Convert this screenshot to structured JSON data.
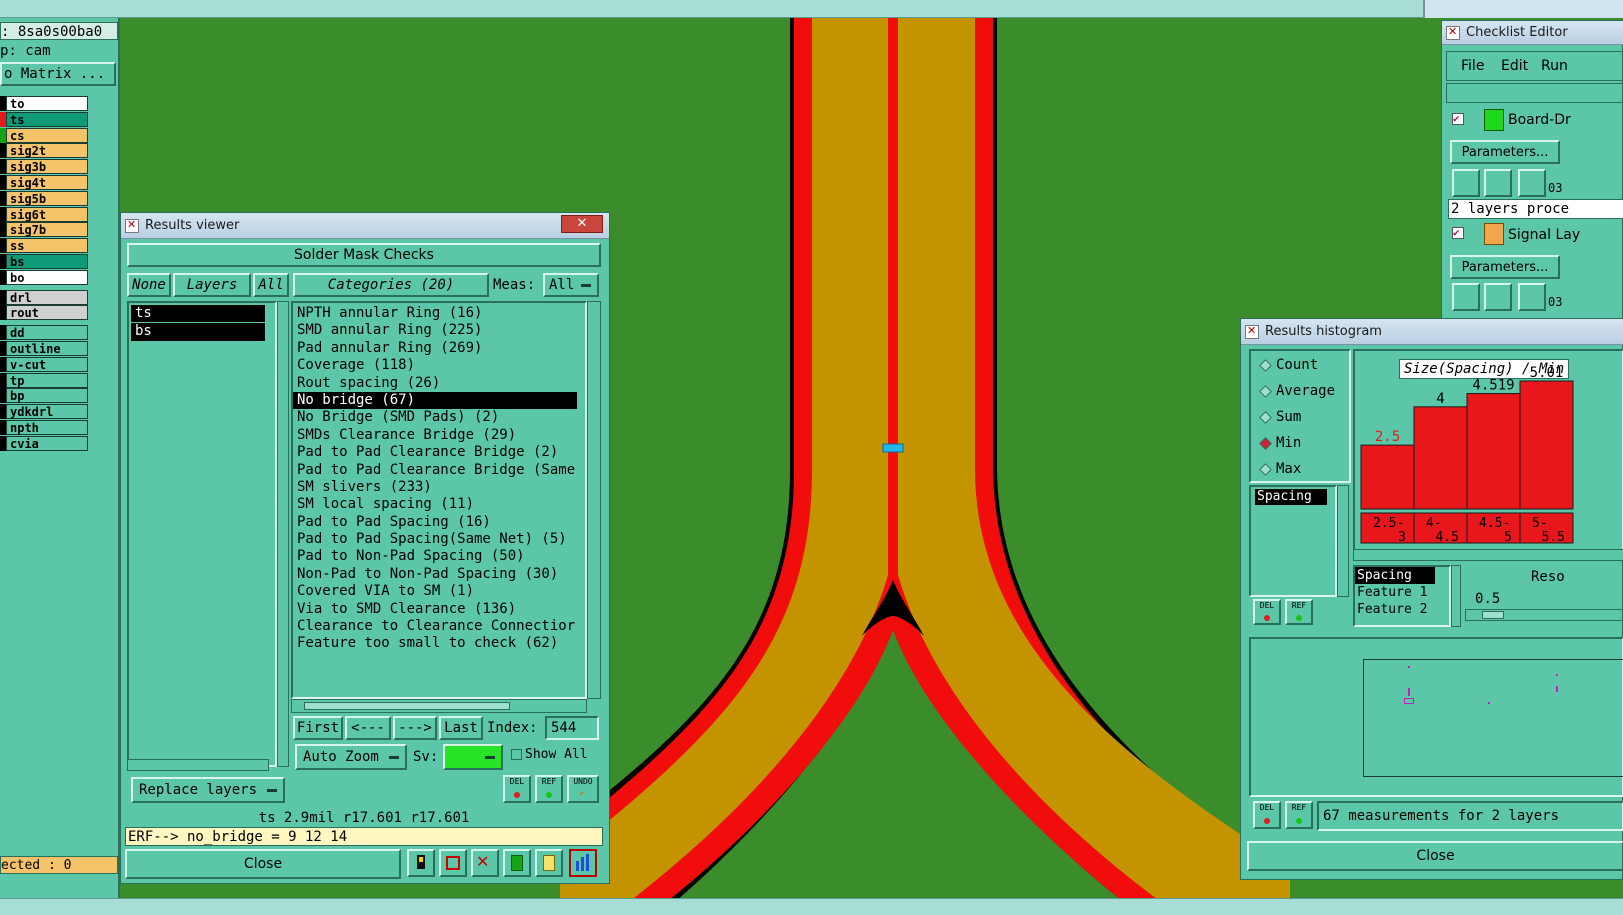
{
  "job_info": {
    "job_line": ": 8sa0s00ba0",
    "step_line": "p: cam",
    "matrix_button": "o Matrix ..."
  },
  "layers": [
    {
      "name": "to",
      "color": "#ffffff"
    },
    {
      "name": "ts",
      "color": "#0f9a78",
      "selected": true
    },
    {
      "name": "cs",
      "color": "#f5c46a"
    },
    {
      "name": "sig2t",
      "color": "#f5c46a"
    },
    {
      "name": "sig3b",
      "color": "#f5c46a"
    },
    {
      "name": "sig4t",
      "color": "#f5c46a"
    },
    {
      "name": "sig5b",
      "color": "#f5c46a"
    },
    {
      "name": "sig6t",
      "color": "#f5c46a"
    },
    {
      "name": "sig7b",
      "color": "#f5c46a"
    },
    {
      "name": "ss",
      "color": "#f5c46a"
    },
    {
      "name": "bs",
      "color": "#0f9a78"
    },
    {
      "name": "bo",
      "color": "#ffffff"
    },
    {
      "name": "drl",
      "color": "#d0d0d0"
    },
    {
      "name": "rout",
      "color": "#d0d0d0"
    },
    {
      "name": "dd",
      "color": "#5cc7a8"
    },
    {
      "name": "outline",
      "color": "#5cc7a8"
    },
    {
      "name": "v-cut",
      "color": "#5cc7a8"
    },
    {
      "name": "tp",
      "color": "#5cc7a8"
    },
    {
      "name": "bp",
      "color": "#5cc7a8"
    },
    {
      "name": "ydkdrl",
      "color": "#5cc7a8"
    },
    {
      "name": "npth",
      "color": "#5cc7a8"
    },
    {
      "name": "cvia",
      "color": "#5cc7a8"
    }
  ],
  "selected_count": "ected : 0",
  "results_viewer": {
    "title": "Results viewer",
    "header": "Solder Mask Checks",
    "none_btn": "None",
    "layers_btn": "Layers",
    "all_btn": "All",
    "categories_btn": "Categories (20)",
    "meas_label": "Meas:",
    "meas_value": "All",
    "layer_list": [
      "ts",
      "bs"
    ],
    "categories": [
      "NPTH annular Ring (16)",
      "SMD annular Ring (225)",
      "Pad annular Ring (269)",
      "Coverage (118)",
      "Rout spacing (26)",
      "No bridge (67)",
      "No Bridge (SMD Pads) (2)",
      "SMDs Clearance Bridge (29)",
      "Pad to Pad Clearance Bridge (2)",
      "Pad to Pad Clearance Bridge (Same",
      "SM slivers (233)",
      "SM local spacing (11)",
      "Pad to Pad Spacing (16)",
      "Pad to Pad Spacing(Same Net) (5)",
      "Pad to Non-Pad Spacing (50)",
      "Non-Pad to Non-Pad Spacing (30)",
      "Covered VIA to SM (1)",
      "Via to SMD Clearance (136)",
      "Clearance to Clearance Connectior",
      "Feature too small to check (62)"
    ],
    "selected_category_index": 5,
    "first_btn": "First",
    "prev_btn": "<---",
    "next_btn": "--->",
    "last_btn": "Last",
    "index_label": "Index:",
    "index_value": "544",
    "auto_zoom_btn": "Auto Zoom",
    "sv_label": "Sv:",
    "show_all_label": "Show All",
    "replace_layers_btn": "Replace layers",
    "del_btn": "DEL",
    "ref_btn": "REF",
    "undo_btn": "UNDO",
    "status_line": "ts 2.9mil  r17.601  r17.601",
    "erf_line": "ERF--> no_bridge = 9 12 14",
    "close_btn": "Close"
  },
  "checklist_editor": {
    "title": "Checklist Editor",
    "menu": [
      "File",
      "Edit",
      "Run"
    ],
    "items": [
      {
        "name": "Board-Dr",
        "params": "Parameters...",
        "count": "03"
      },
      {
        "name": "Signal Lay",
        "params": "Parameters...",
        "count": "03"
      }
    ],
    "status": "2 layers proce"
  },
  "results_histogram": {
    "title": "Results histogram",
    "modes": [
      "Count",
      "Average",
      "Sum",
      "Min",
      "Max"
    ],
    "selected_mode": "Min",
    "chart_title": "Size(Spacing) / Min",
    "list_item": "Spacing",
    "attrs": [
      "Spacing",
      "Feature 1",
      "Feature 2"
    ],
    "reso_label": "Reso",
    "reso_value": "0.5",
    "del_btn": "DEL",
    "ref_btn": "REF",
    "summary": "67 measurements for 2 layers",
    "close_btn": "Close"
  },
  "chart_data": {
    "type": "bar",
    "title": "Size(Spacing) / Min",
    "categories": [
      "2.5-3",
      "4-4.5",
      "4.5-5",
      "5-5.5"
    ],
    "category_labels_top": [
      "2.5-",
      "4-",
      "4.5-",
      "5-"
    ],
    "category_labels_bottom": [
      "3",
      "4.5",
      "5",
      "5.5"
    ],
    "values": [
      2.5,
      4,
      4.519,
      5.01
    ],
    "value_labels": [
      "2.5",
      "4",
      "4.519",
      "5.01"
    ],
    "bar_color": "#e8171b"
  },
  "colors": {
    "board_green": "#3b8c2a",
    "trace_red": "#f20d0d",
    "copper_gold": "#c39400",
    "panel_teal": "#5cc7a8"
  }
}
